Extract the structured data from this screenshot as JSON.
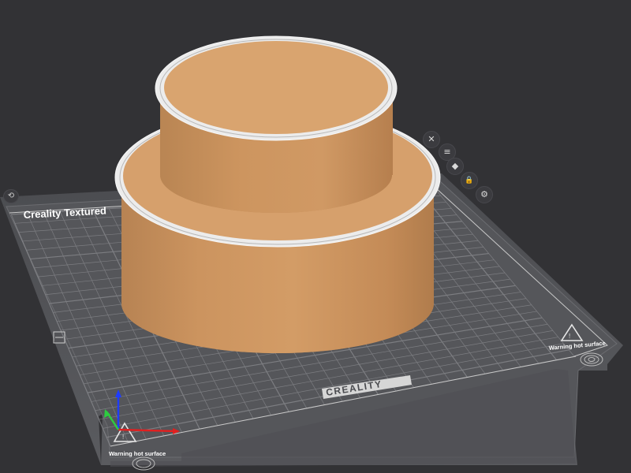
{
  "bed": {
    "brand_text": "Creality Textured",
    "logo_text": "CREALITY",
    "warning_text": "Warning hot surface",
    "warning_text_left": "Warning hot surface"
  },
  "side_toolbar": {
    "items": [
      {
        "icon": "view-icon",
        "glyph": "✕"
      },
      {
        "icon": "layers-icon",
        "glyph": "≡"
      },
      {
        "icon": "paint-icon",
        "glyph": "◆"
      },
      {
        "icon": "lock-icon",
        "glyph": "🔒"
      },
      {
        "icon": "gear-icon",
        "glyph": "⚙"
      }
    ]
  },
  "corner_button": {
    "icon": "orient-icon",
    "glyph": "⟲"
  },
  "colors": {
    "background": "#323235",
    "bed": "#55565a",
    "grid": "#8a8b8f",
    "model": "#d29a63",
    "model_rim": "#ececec",
    "axis_x": "#e02020",
    "axis_y": "#2ecc40",
    "axis_z": "#1e3cff"
  }
}
